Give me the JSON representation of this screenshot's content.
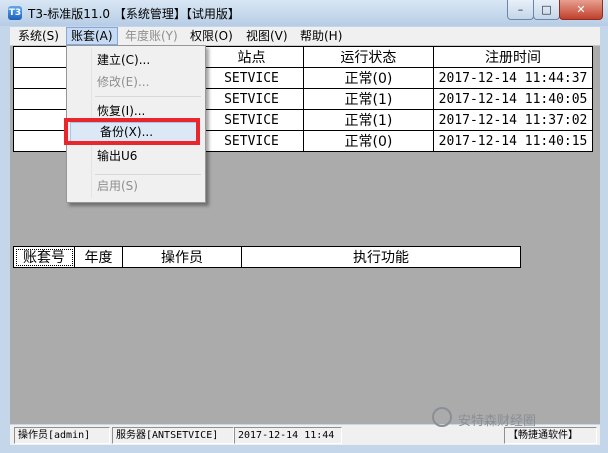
{
  "window": {
    "title": "T3-标准版11.0 【系统管理】【试用版】",
    "icon_label": "T3",
    "controls": {
      "minimize": "–",
      "maximize": "□",
      "close": "✕"
    }
  },
  "menubar": {
    "items": [
      {
        "label": "系统(S)",
        "state": "normal"
      },
      {
        "label": "账套(A)",
        "state": "active"
      },
      {
        "label": "年度账(Y)",
        "state": "disabled"
      },
      {
        "label": "权限(O)",
        "state": "normal"
      },
      {
        "label": "视图(V)",
        "state": "normal"
      },
      {
        "label": "帮助(H)",
        "state": "normal"
      }
    ]
  },
  "dropdown": {
    "items": [
      {
        "label": "建立(C)...",
        "state": "normal"
      },
      {
        "label": "修改(E)...",
        "state": "disabled"
      },
      {
        "label": "恢复(I)...",
        "state": "normal"
      },
      {
        "label": "备份(X)...",
        "state": "highlighted"
      },
      {
        "label": "输出U6",
        "state": "normal"
      },
      {
        "label": "启用(S)",
        "state": "disabled"
      }
    ]
  },
  "top_table": {
    "headers": [
      "",
      "站点",
      "运行状态",
      "注册时间"
    ],
    "rows": [
      {
        "col1": "",
        "site": "SETVICE",
        "status": "正常(0)",
        "time": "2017-12-14 11:44:37"
      },
      {
        "col1": "",
        "site": "SETVICE",
        "status": "正常(1)",
        "time": "2017-12-14 11:40:05"
      },
      {
        "col1": "",
        "site": "SETVICE",
        "status": "正常(1)",
        "time": "2017-12-14 11:37:02"
      },
      {
        "col1": "",
        "site": "SETVICE",
        "status": "正常(0)",
        "time": "2017-12-14 11:40:15"
      }
    ]
  },
  "bottom_table": {
    "headers": [
      "账套号",
      "年度",
      "操作员",
      "执行功能"
    ]
  },
  "statusbar": {
    "operator": "操作员[admin]",
    "server": "服务器[ANTSETVICE]",
    "datetime": "2017-12-14 11:44",
    "company": "【畅捷通软件】"
  },
  "watermark": {
    "text": "安特森财经圈"
  },
  "colors": {
    "highlight_box": "#e8262b",
    "content_bg": "#ababab",
    "title_bg": "#c4d6ea"
  }
}
